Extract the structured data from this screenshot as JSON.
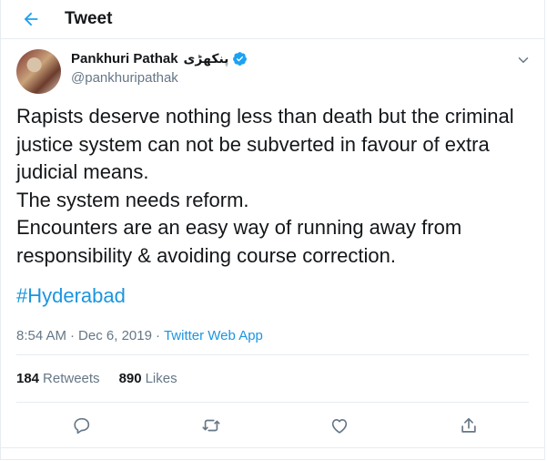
{
  "header": {
    "title": "Tweet",
    "back_icon": "arrow-left-icon",
    "accent": "#1da1f2"
  },
  "author": {
    "name": "Pankhuri Pathak",
    "name_urdu": "پنکھڑی",
    "handle": "@pankhuripathak",
    "verified": true,
    "verified_icon": "verified-badge-icon",
    "menu_icon": "chevron-down-icon"
  },
  "tweet": {
    "lines": [
      "Rapists deserve nothing less than death but the criminal",
      "justice system can not be subverted in favour of extra",
      "judicial means.",
      "The system needs reform.",
      "Encounters are an easy way of running away from",
      "responsibility & avoiding course correction."
    ],
    "hashtag": "#Hyderabad",
    "time": "8:54 AM",
    "separator": "·",
    "date": "Dec 6, 2019",
    "source": "Twitter Web App"
  },
  "stats": {
    "retweets_count": "184",
    "retweets_label": "Retweets",
    "likes_count": "890",
    "likes_label": "Likes"
  },
  "actions": {
    "reply_icon": "reply-icon",
    "retweet_icon": "retweet-icon",
    "like_icon": "heart-icon",
    "share_icon": "share-icon",
    "icon_color": "#657786"
  },
  "colors": {
    "link": "#1b95e0",
    "text": "#14171a",
    "secondary": "#657786",
    "border": "#e6ecf0"
  }
}
